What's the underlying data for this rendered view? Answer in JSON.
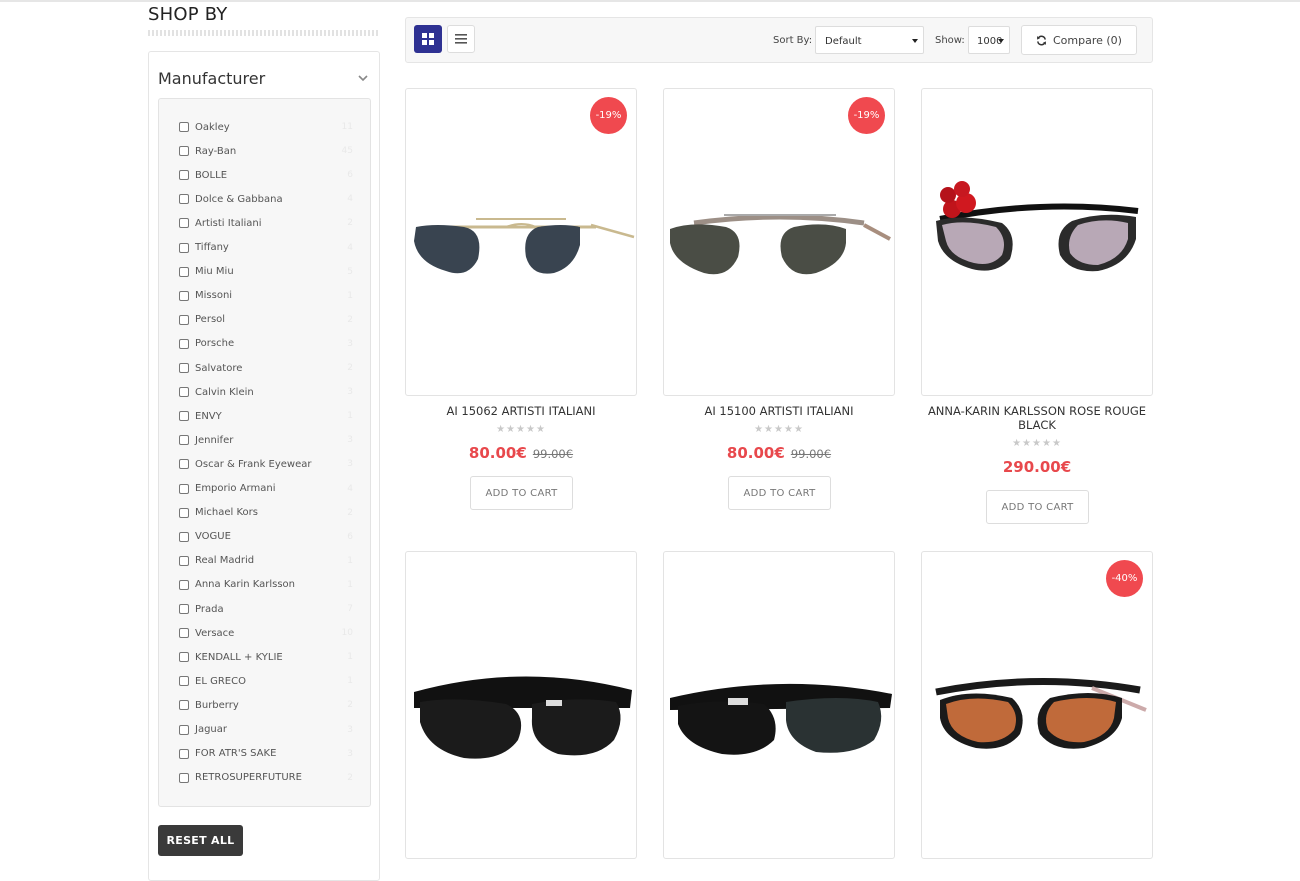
{
  "sidebar": {
    "title": "SHOP BY",
    "filter_title": "Manufacturer",
    "reset_label": "RESET ALL",
    "manufacturers": [
      {
        "label": "Oakley",
        "count": "11"
      },
      {
        "label": "Ray-Ban",
        "count": "45"
      },
      {
        "label": "BOLLE",
        "count": "6"
      },
      {
        "label": "Dolce & Gabbana",
        "count": "4"
      },
      {
        "label": "Artisti Italiani",
        "count": "2"
      },
      {
        "label": "Tiffany",
        "count": "4"
      },
      {
        "label": "Miu Miu",
        "count": "5"
      },
      {
        "label": "Missoni",
        "count": "1"
      },
      {
        "label": "Persol",
        "count": "2"
      },
      {
        "label": "Porsche",
        "count": "3"
      },
      {
        "label": "Salvatore",
        "count": "2"
      },
      {
        "label": "Calvin Klein",
        "count": "3"
      },
      {
        "label": "ENVY",
        "count": "1"
      },
      {
        "label": "Jennifer",
        "count": "3"
      },
      {
        "label": "Oscar & Frank Eyewear",
        "count": "3"
      },
      {
        "label": "Emporio Armani",
        "count": "4"
      },
      {
        "label": "Michael Kors",
        "count": "2"
      },
      {
        "label": "VOGUE",
        "count": "6"
      },
      {
        "label": "Real Madrid",
        "count": "1"
      },
      {
        "label": "Anna Karin Karlsson",
        "count": "1"
      },
      {
        "label": "Prada",
        "count": "7"
      },
      {
        "label": "Versace",
        "count": "10"
      },
      {
        "label": "KENDALL + KYLIE",
        "count": "1"
      },
      {
        "label": "EL GRECO",
        "count": "1"
      },
      {
        "label": "Burberry",
        "count": "2"
      },
      {
        "label": "Jaguar",
        "count": "3"
      },
      {
        "label": "FOR ATR'S SAKE",
        "count": "3"
      },
      {
        "label": "RETROSUPERFUTURE",
        "count": "2"
      }
    ]
  },
  "toolbar": {
    "sort_label": "Sort By:",
    "sort_value": "Default",
    "show_label": "Show:",
    "show_value": "1000",
    "compare_label": "Compare (0)"
  },
  "products": [
    {
      "name": "AI 15062 ARTISTI ITALIANI",
      "badge": "-19%",
      "price": "80.00€",
      "old_price": "99.00€",
      "stars": "★★★★★",
      "cta": "ADD TO CART",
      "style": "aviator-gold"
    },
    {
      "name": "AI 15100 ARTISTI ITALIANI",
      "badge": "-19%",
      "price": "80.00€",
      "old_price": "99.00€",
      "stars": "★★★★★",
      "cta": "ADD TO CART",
      "style": "aviator-tortoise"
    },
    {
      "name": "ANNA-KARIN KARLSSON ROSE ROUGE BLACK",
      "badge": "",
      "price": "290.00€",
      "old_price": "",
      "stars": "★★★★★",
      "cta": "ADD TO CART",
      "style": "cateye-roses"
    },
    {
      "name": "",
      "badge": "",
      "price": "",
      "old_price": "",
      "stars": "",
      "cta": "",
      "style": "wrap-black"
    },
    {
      "name": "",
      "badge": "",
      "price": "",
      "old_price": "",
      "stars": "",
      "cta": "",
      "style": "wrap-black-2"
    },
    {
      "name": "",
      "badge": "-40%",
      "price": "",
      "old_price": "",
      "stars": "",
      "cta": "",
      "style": "wrap-mirror"
    }
  ]
}
